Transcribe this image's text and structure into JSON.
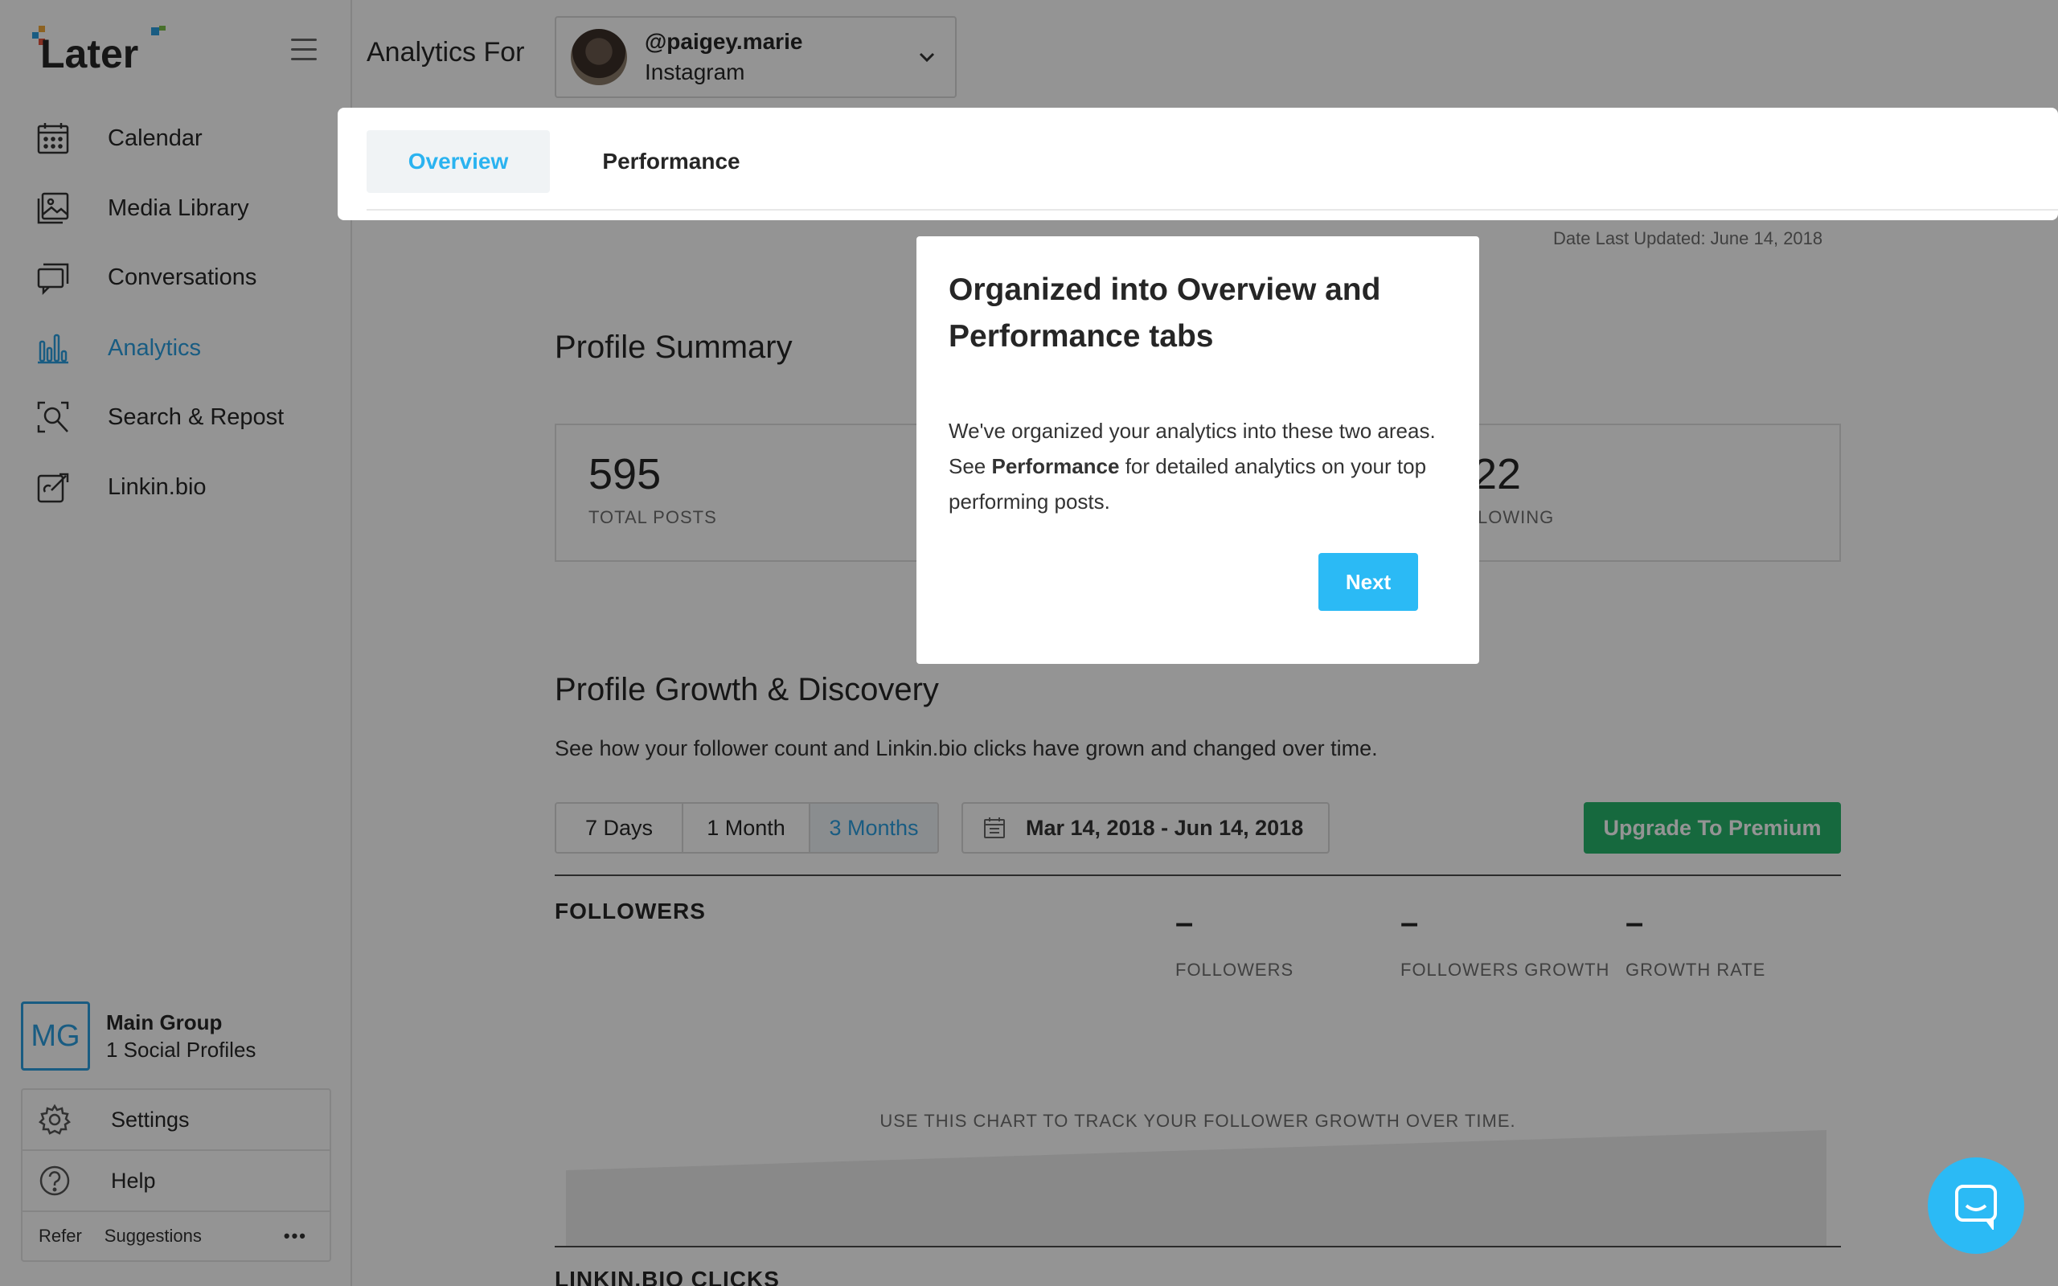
{
  "app": {
    "logo_text": "Later"
  },
  "sidebar": {
    "items": [
      {
        "label": "Calendar",
        "icon": "calendar-icon"
      },
      {
        "label": "Media Library",
        "icon": "media-library-icon"
      },
      {
        "label": "Conversations",
        "icon": "conversations-icon"
      },
      {
        "label": "Analytics",
        "icon": "analytics-icon",
        "active": true
      },
      {
        "label": "Search & Repost",
        "icon": "search-repost-icon"
      },
      {
        "label": "Linkin.bio",
        "icon": "linkinbio-icon"
      }
    ],
    "group": {
      "initials": "MG",
      "name": "Main Group",
      "profiles": "1 Social Profiles"
    },
    "bottom": {
      "settings": "Settings",
      "help": "Help",
      "refer": "Refer",
      "suggestions": "Suggestions",
      "more": "•••"
    }
  },
  "header": {
    "title": "Analytics For",
    "account": {
      "handle": "@paigey.marie",
      "network": "Instagram"
    }
  },
  "tabs": [
    {
      "label": "Overview",
      "selected": true
    },
    {
      "label": "Performance",
      "selected": false
    }
  ],
  "date_updated": "Date Last Updated: June 14, 2018",
  "profile_summary": {
    "title": "Profile Summary",
    "stats": [
      {
        "value": "595",
        "label": "TOTAL POSTS"
      },
      {
        "value": "22",
        "label": "LOWING"
      }
    ]
  },
  "growth": {
    "title": "Profile Growth & Discovery",
    "description": "See how your follower count and Linkin.bio clicks have grown and changed over time.",
    "ranges": [
      "7 Days",
      "1 Month",
      "3 Months"
    ],
    "selected_range": "3 Months",
    "date_range": "Mar 14, 2018 - Jun 14, 2018",
    "upgrade_label": "Upgrade To Premium",
    "followers_title": "FOLLOWERS",
    "metrics": [
      {
        "value": "–",
        "label": "FOLLOWERS"
      },
      {
        "value": "–",
        "label": "FOLLOWERS GROWTH"
      },
      {
        "value": "–",
        "label": "GROWTH RATE"
      }
    ],
    "chart_hint": "USE THIS CHART TO TRACK YOUR FOLLOWER GROWTH OVER TIME.",
    "linkin_title": "LINKIN.BIO CLICKS"
  },
  "modal": {
    "title": "Organized into Overview and Performance tabs",
    "body_pre": "We've organized your analytics into these two areas. See ",
    "body_bold": "Performance",
    "body_post": " for detailed analytics on your top performing posts.",
    "next_label": "Next"
  },
  "colors": {
    "accent": "#2b9fe0",
    "primary_button": "#2bbaf5",
    "upgrade": "#27b56b"
  }
}
